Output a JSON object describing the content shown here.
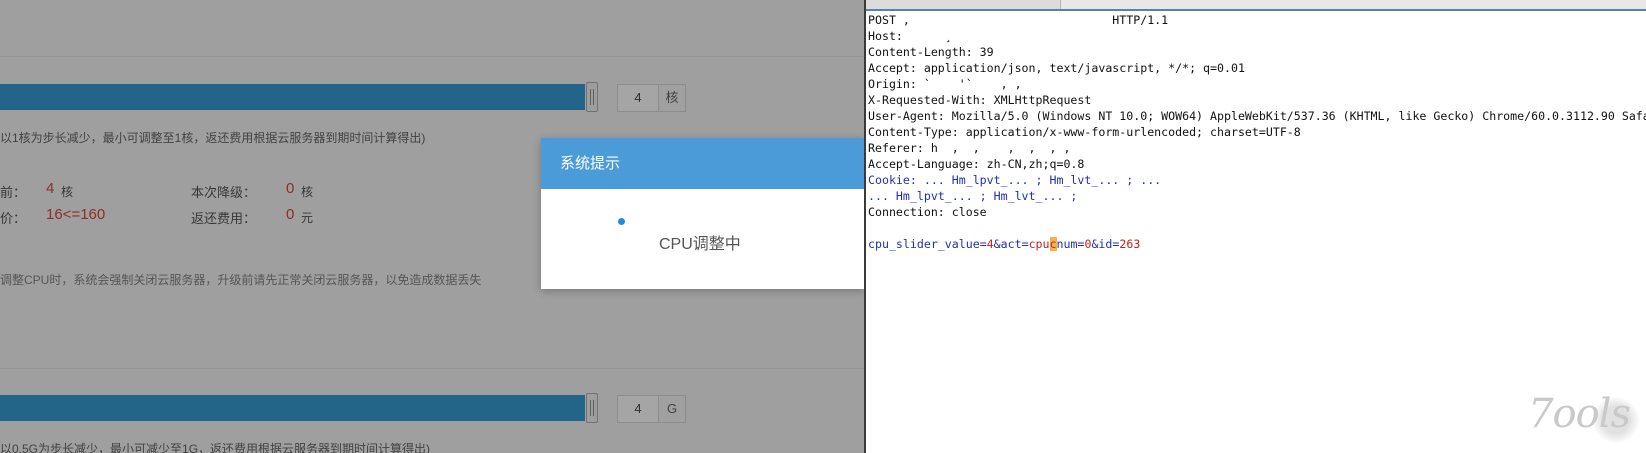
{
  "cpu": {
    "input_value": "4",
    "unit": "核",
    "hint": "以1核为步长减少，最小可调整至1核，返还费用根据云服务器到期时间计算得出)",
    "current_label": "前：",
    "current_value": "4",
    "current_unit": "核",
    "downgrade_label": "本次降级：",
    "downgrade_value": "0",
    "downgrade_unit": "核",
    "price_label": "价：",
    "price_value": "16<=160",
    "refund_label": "返还费用：",
    "refund_value": "0",
    "refund_unit": "元",
    "warning": "调整CPU时，系统会强制关闭云服务器，升级前请先正常关闭云服务器，以免造成数据丢失"
  },
  "memory": {
    "input_value": "4",
    "unit": "G",
    "hint": "以0.5G为步长减少，最小可减少至1G，返还费用根据云服务器到期时间计算得出)"
  },
  "dialog": {
    "title": "系统提示",
    "message": "CPU调整中"
  },
  "request": {
    "lines": [
      "POST ,                             HTTP/1.1",
      "Host:      ¸",
      "Content-Length: 39",
      "Accept: application/json, text/javascript, */*; q=0.01",
      "Origin: `    '`    , ,",
      "X-Requested-With: XMLHttpRequest",
      "User-Agent: Mozilla/5.0 (Windows NT 10.0; WOW64) AppleWebKit/537.36 (KHTML, like Gecko) Chrome/60.0.3112.90 Safari/537.36",
      "Content-Type: application/x-www-form-urlencoded; charset=UTF-8",
      "Referer: h  ,  ,    ,  ,  , ,",
      "Accept-Language: zh-CN,zh;q=0.8"
    ],
    "cookie_lines": [
      "Cookie: ... Hm_lpvt_... ; Hm_lvt_... ; ...",
      "... Hm_lpvt_... ; Hm_lvt_... ;"
    ],
    "connection": "Connection: close",
    "payload": {
      "p1": "cpu_slider_value",
      "v1": "4",
      "amp": "&",
      "p2": "act",
      "v2_a": "cpu",
      "v2_b": "c",
      "p3": "num",
      "v3": "0",
      "p4": "id",
      "v4": "263"
    }
  },
  "watermark": {
    "text": "7ools"
  }
}
